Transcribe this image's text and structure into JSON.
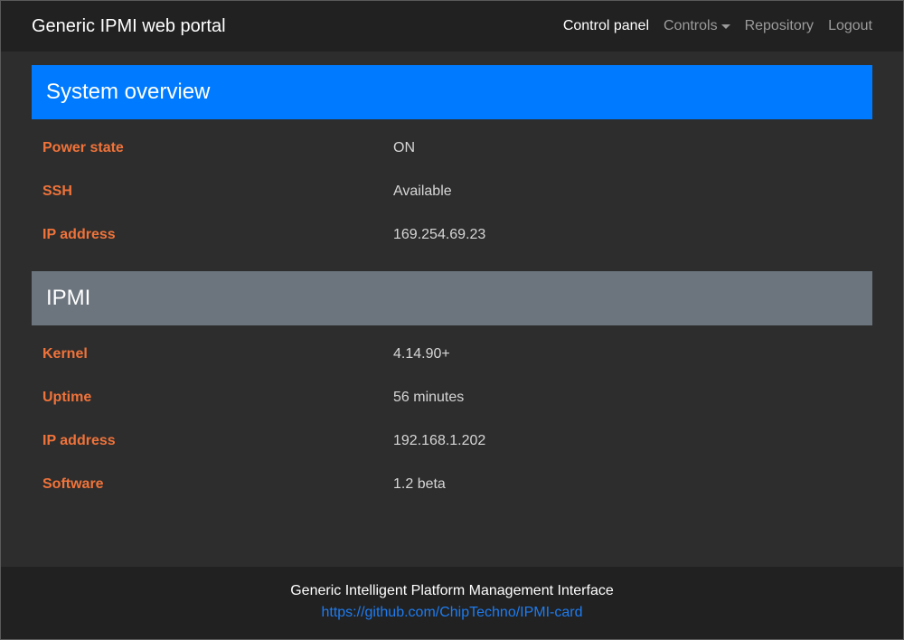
{
  "navbar": {
    "brand": "Generic IPMI web portal",
    "links": [
      {
        "label": "Control panel",
        "active": true
      },
      {
        "label": "Controls",
        "dropdown": true
      },
      {
        "label": "Repository"
      },
      {
        "label": "Logout"
      }
    ]
  },
  "sections": [
    {
      "title": "System overview",
      "color": "#007bff",
      "rows": [
        {
          "label": "Power state",
          "value": "ON"
        },
        {
          "label": "SSH",
          "value": "Available"
        },
        {
          "label": "IP address",
          "value": "169.254.69.23"
        }
      ]
    },
    {
      "title": "IPMI",
      "color": "#6c757d",
      "rows": [
        {
          "label": "Kernel",
          "value": "4.14.90+"
        },
        {
          "label": "Uptime",
          "value": "56 minutes"
        },
        {
          "label": "IP address",
          "value": "192.168.1.202"
        },
        {
          "label": "Software",
          "value": "1.2 beta"
        }
      ]
    }
  ],
  "footer": {
    "title": "Generic Intelligent Platform Management Interface",
    "link": "https://github.com/ChipTechno/IPMI-card"
  },
  "colors": {
    "label": "#f0733a",
    "link": "#1e7cf0",
    "navbar": "#212121",
    "background": "#2d2d2d"
  }
}
